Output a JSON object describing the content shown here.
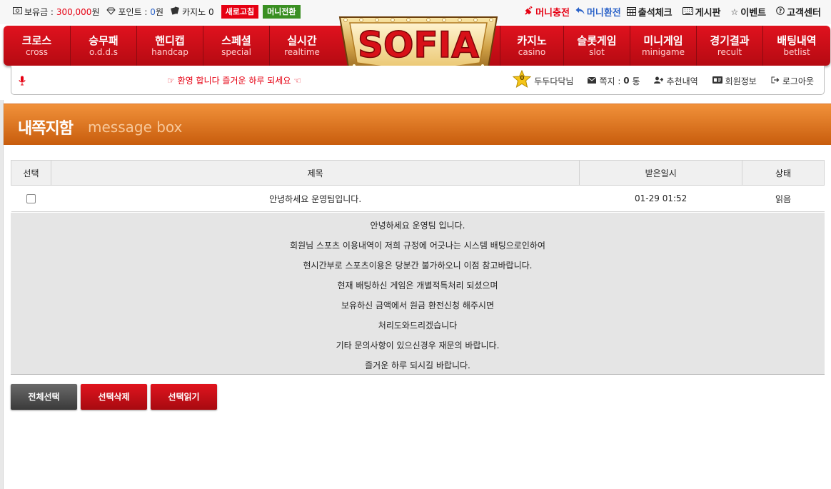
{
  "topbar": {
    "balance_label": "보유금 :",
    "balance_value": "300,000",
    "balance_unit": "원",
    "point_label": "포인트 :",
    "point_value": "0",
    "point_unit": "원",
    "casino_label": "카지노",
    "casino_value": "0",
    "refresh_button": "새로고침",
    "convert_button": "머니전환",
    "links": {
      "charge": "머니충전",
      "exchange": "머니환전",
      "attendance": "출석체크",
      "board": "게시판",
      "event": "이벤트",
      "support": "고객센터"
    }
  },
  "nav": {
    "logo_text": "SOFIA",
    "items": [
      {
        "ko": "크로스",
        "en": "cross"
      },
      {
        "ko": "승무패",
        "en": "o.d.d.s"
      },
      {
        "ko": "핸디캡",
        "en": "handcap"
      },
      {
        "ko": "스페셜",
        "en": "special"
      },
      {
        "ko": "실시간",
        "en": "realtime"
      },
      {
        "ko": "카지노",
        "en": "casino"
      },
      {
        "ko": "슬롯게임",
        "en": "slot"
      },
      {
        "ko": "미니게임",
        "en": "minigame"
      },
      {
        "ko": "경기결과",
        "en": "recult"
      },
      {
        "ko": "배팅내역",
        "en": "betlist"
      }
    ]
  },
  "subbar": {
    "welcome": "환영 합니다 즐거운 하루 되세요",
    "level_badge": "0",
    "username": "두두다닥님",
    "messages_label": "쪽지 :",
    "messages_count": "0",
    "messages_unit": "통",
    "recommend": "추천내역",
    "member_info": "회원정보",
    "logout": "로그아웃"
  },
  "page": {
    "title_ko": "내쪽지함",
    "title_en": "message box"
  },
  "table": {
    "headers": [
      "선택",
      "제목",
      "받은일시",
      "상태"
    ],
    "rows": [
      {
        "title": "안녕하세요 운영팀입니다.",
        "date": "01-29 01:52",
        "status": "읽음"
      }
    ]
  },
  "message": {
    "lines": [
      "안녕하세요 운영팀 입니다.",
      "회원님 스포츠 이용내역이 저희 규정에 어긋나는 시스템 배팅으로인하여",
      "현시간부로 스포츠이용은 당분간 불가하오니 이점 참고바랍니다.",
      "현재 배팅하신 게임은 개별적특처리 되셨으며",
      "보유하신 금액에서 원금 환전신청 해주시면",
      "처리도와드리겠습니다",
      "기타 문의사항이 있으신경우 재문의 바랍니다.",
      "즐거운 하루 되시길 바랍니다."
    ]
  },
  "actions": {
    "select_all": "전체선택",
    "delete_selected": "선택삭제",
    "read_selected": "선택읽기"
  }
}
